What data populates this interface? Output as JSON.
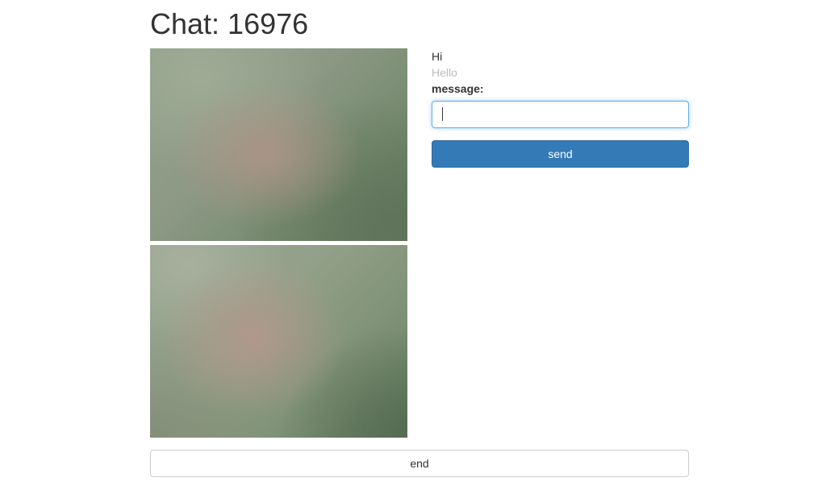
{
  "page": {
    "title": "Chat: 16976"
  },
  "videos": {
    "remote": {
      "label": "remote-video"
    },
    "local": {
      "label": "local-video"
    }
  },
  "messages": [
    {
      "text": "Hi",
      "from": "remote"
    },
    {
      "text": "Hello",
      "from": "local"
    }
  ],
  "form": {
    "label": "message:",
    "input_value": "",
    "send_label": "send"
  },
  "footer": {
    "end_label": "end"
  },
  "colors": {
    "primary": "#337ab7",
    "focus_border": "#66afe9",
    "muted_text": "#bbbbbb"
  }
}
